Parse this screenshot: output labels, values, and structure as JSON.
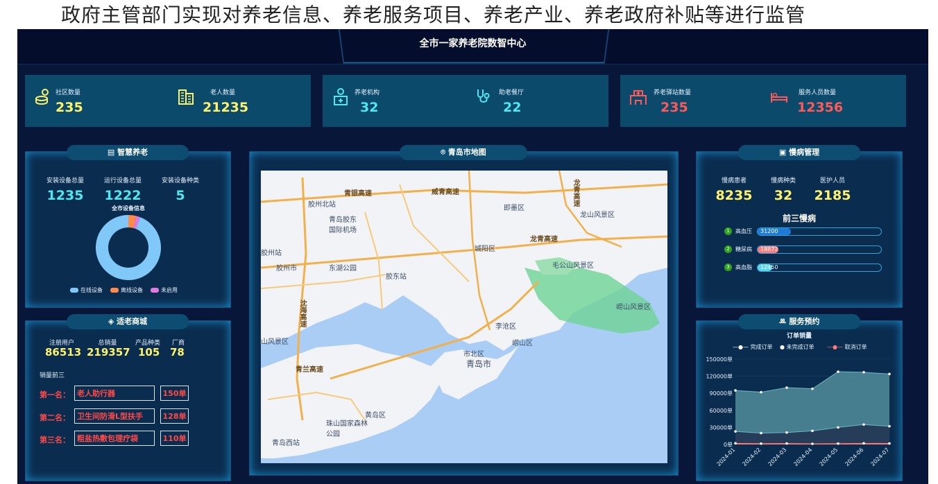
{
  "caption": "政府主管部门实现对养老信息、养老服务项目、养老产业、养老政府补贴等进行监管",
  "header": {
    "title": "全市一家养老院数智中心"
  },
  "stat_cards": [
    {
      "items": [
        {
          "label": "社区数量",
          "value": "235",
          "icon": "coin-stack-icon",
          "color": "#fff36b"
        },
        {
          "label": "老人数量",
          "value": "21235",
          "icon": "building-icon",
          "color": "#fff36b"
        }
      ]
    },
    {
      "items": [
        {
          "label": "养老机构",
          "value": "32",
          "icon": "medical-home-icon",
          "color": "#4ee8f0"
        },
        {
          "label": "助老餐厅",
          "value": "22",
          "icon": "stethoscope-icon",
          "color": "#4ee8f0"
        }
      ]
    },
    {
      "items": [
        {
          "label": "养老驿站数量",
          "value": "235",
          "icon": "hospital-icon",
          "color": "#ff5a5a"
        },
        {
          "label": "服务人员数量",
          "value": "12356",
          "icon": "bed-icon",
          "color": "#ff5a5a"
        }
      ]
    }
  ],
  "smart_elderly": {
    "title": "智慧养老",
    "labels": [
      "安装设备总量",
      "运行设备总量",
      "安装设备种类"
    ],
    "values": [
      "1235",
      "1222",
      "5"
    ],
    "donut_title": "全市设备信息",
    "legend": [
      "在线设备",
      "离线设备",
      "未启用"
    ],
    "legend_colors": [
      "#7fc8f8",
      "#ff8a4a",
      "#e07ae0"
    ],
    "donut_values": [
      94,
      4,
      2
    ]
  },
  "mall": {
    "title": "适老商城",
    "labels": [
      "注册用户",
      "总销量",
      "产品种类",
      "厂商"
    ],
    "values": [
      "86513",
      "219357",
      "105",
      "78"
    ],
    "top_title": "销量前三",
    "ranks": [
      {
        "label": "第一名：",
        "name": "老人助行器",
        "sales": "150单"
      },
      {
        "label": "第二名：",
        "name": "卫生间防滑L型扶手",
        "sales": "128单"
      },
      {
        "label": "第三名：",
        "name": "粗盐热敷包理疗袋",
        "sales": "110单"
      }
    ]
  },
  "map": {
    "title": "青岛市地图",
    "labels": [
      "青银高速",
      "威青高速",
      "龙青高速",
      "即墨区",
      "龙山风景区",
      "胶州北站",
      "青岛胶东国际机场",
      "城阳区",
      "龙青高速",
      "胶州站",
      "胶州市",
      "东湖公园",
      "胶东站",
      "毛公山风景区",
      "崂山风景区",
      "青兰高速",
      "李沧区",
      "崂山区",
      "市北区",
      "青岛市",
      "珠山国家森林公园",
      "黄岛区",
      "青岛西站",
      "山风景区",
      "沈海高速"
    ]
  },
  "chronic": {
    "title": "慢病管理",
    "labels": [
      "慢病患者",
      "慢病种类",
      "医护人员"
    ],
    "values": [
      "8235",
      "32",
      "2185"
    ],
    "top_title": "前三慢病",
    "diseases": [
      {
        "rank": "1",
        "name": "高血压",
        "value": "31200",
        "fraction": 0.27,
        "color": "#1f7ad8"
      },
      {
        "rank": "2",
        "name": "糖尿病",
        "value": "18872",
        "fraction": 0.17,
        "color": "#ff7a7a"
      },
      {
        "rank": "3",
        "name": "高血脂",
        "value": "12450",
        "fraction": 0.12,
        "color": "#5fd6e8"
      }
    ]
  },
  "service": {
    "title": "服务预约",
    "chart_title": "订单销量",
    "legend": [
      "完成订单",
      "未完成订单",
      "取消订单"
    ],
    "y_ticks": [
      "150000单",
      "120000单",
      "90000单",
      "60000单",
      "30000单",
      "0单"
    ]
  },
  "chart_data": {
    "type": "area",
    "title": "订单销量",
    "categories": [
      "2024-01",
      "2024-02",
      "2024-03",
      "2024-04",
      "2024-05",
      "2024-06",
      "2024-07"
    ],
    "ylim": [
      0,
      150000
    ],
    "series": [
      {
        "name": "完成订单",
        "values": [
          95000,
          92000,
          100000,
          98000,
          128000,
          127000,
          124000
        ],
        "color": "#4a8393"
      },
      {
        "name": "未完成订单",
        "values": [
          23000,
          20000,
          21000,
          24000,
          30000,
          35000,
          32000
        ],
        "color": "#243a55"
      },
      {
        "name": "取消订单",
        "values": [
          2000,
          1500,
          1800,
          1200,
          1600,
          2000,
          1800
        ],
        "color": "#ff7a7a"
      }
    ],
    "legend_position": "top"
  }
}
